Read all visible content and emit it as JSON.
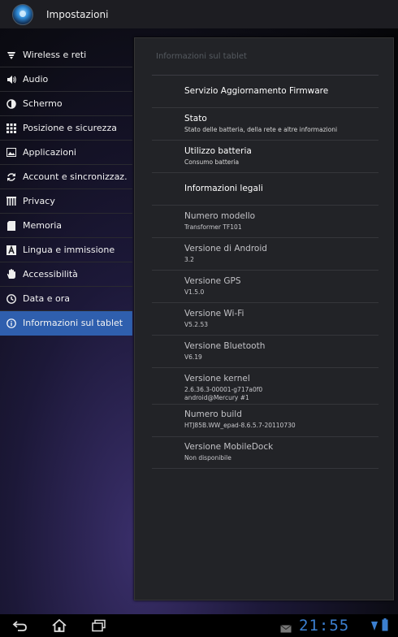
{
  "header": {
    "title": "Impostazioni"
  },
  "sidebar": {
    "items": [
      {
        "label": "Wireless e reti",
        "icon": "wifi-icon"
      },
      {
        "label": "Audio",
        "icon": "speaker-icon"
      },
      {
        "label": "Schermo",
        "icon": "brightness-icon"
      },
      {
        "label": "Posizione e sicurezza",
        "icon": "grid-icon"
      },
      {
        "label": "Applicazioni",
        "icon": "image-icon"
      },
      {
        "label": "Account e sincronizzaz.",
        "icon": "sync-icon"
      },
      {
        "label": "Privacy",
        "icon": "privacy-icon"
      },
      {
        "label": "Memoria",
        "icon": "sd-card-icon"
      },
      {
        "label": "Lingua e immissione",
        "icon": "keyboard-a-icon"
      },
      {
        "label": "Accessibilità",
        "icon": "hand-icon"
      },
      {
        "label": "Data e ora",
        "icon": "clock-icon"
      },
      {
        "label": "Informazioni sul tablet",
        "icon": "info-icon",
        "selected": true
      }
    ]
  },
  "panel": {
    "heading": "Informazioni sul tablet",
    "rows": [
      {
        "title": "Servizio Aggiornamento Firmware",
        "subtitle": ""
      },
      {
        "title": "Stato",
        "subtitle": "Stato delle batteria, della rete e altre informazioni"
      },
      {
        "title": "Utilizzo batteria",
        "subtitle": "Consumo batteria"
      },
      {
        "title": "Informazioni legali",
        "subtitle": ""
      },
      {
        "title": "Numero modello",
        "subtitle": "Transformer TF101"
      },
      {
        "title": "Versione di Android",
        "subtitle": "3.2"
      },
      {
        "title": "Versione GPS",
        "subtitle": "V1.5.0"
      },
      {
        "title": "Versione Wi-Fi",
        "subtitle": "V5.2.53"
      },
      {
        "title": "Versione Bluetooth",
        "subtitle": "V6.19"
      },
      {
        "title": "Versione kernel",
        "subtitle": "2.6.36.3-00001-g717a0f0\nandroid@Mercury #1"
      },
      {
        "title": "Numero build",
        "subtitle": "HTJ85B.WW_epad-8.6.5.7-20110730"
      },
      {
        "title": "Versione MobileDock",
        "subtitle": "Non disponibile"
      }
    ]
  },
  "statusbar": {
    "time": "21:55"
  },
  "colors": {
    "accent": "#2f5fae",
    "clock": "#3b7fd0",
    "panel": "#222327"
  }
}
